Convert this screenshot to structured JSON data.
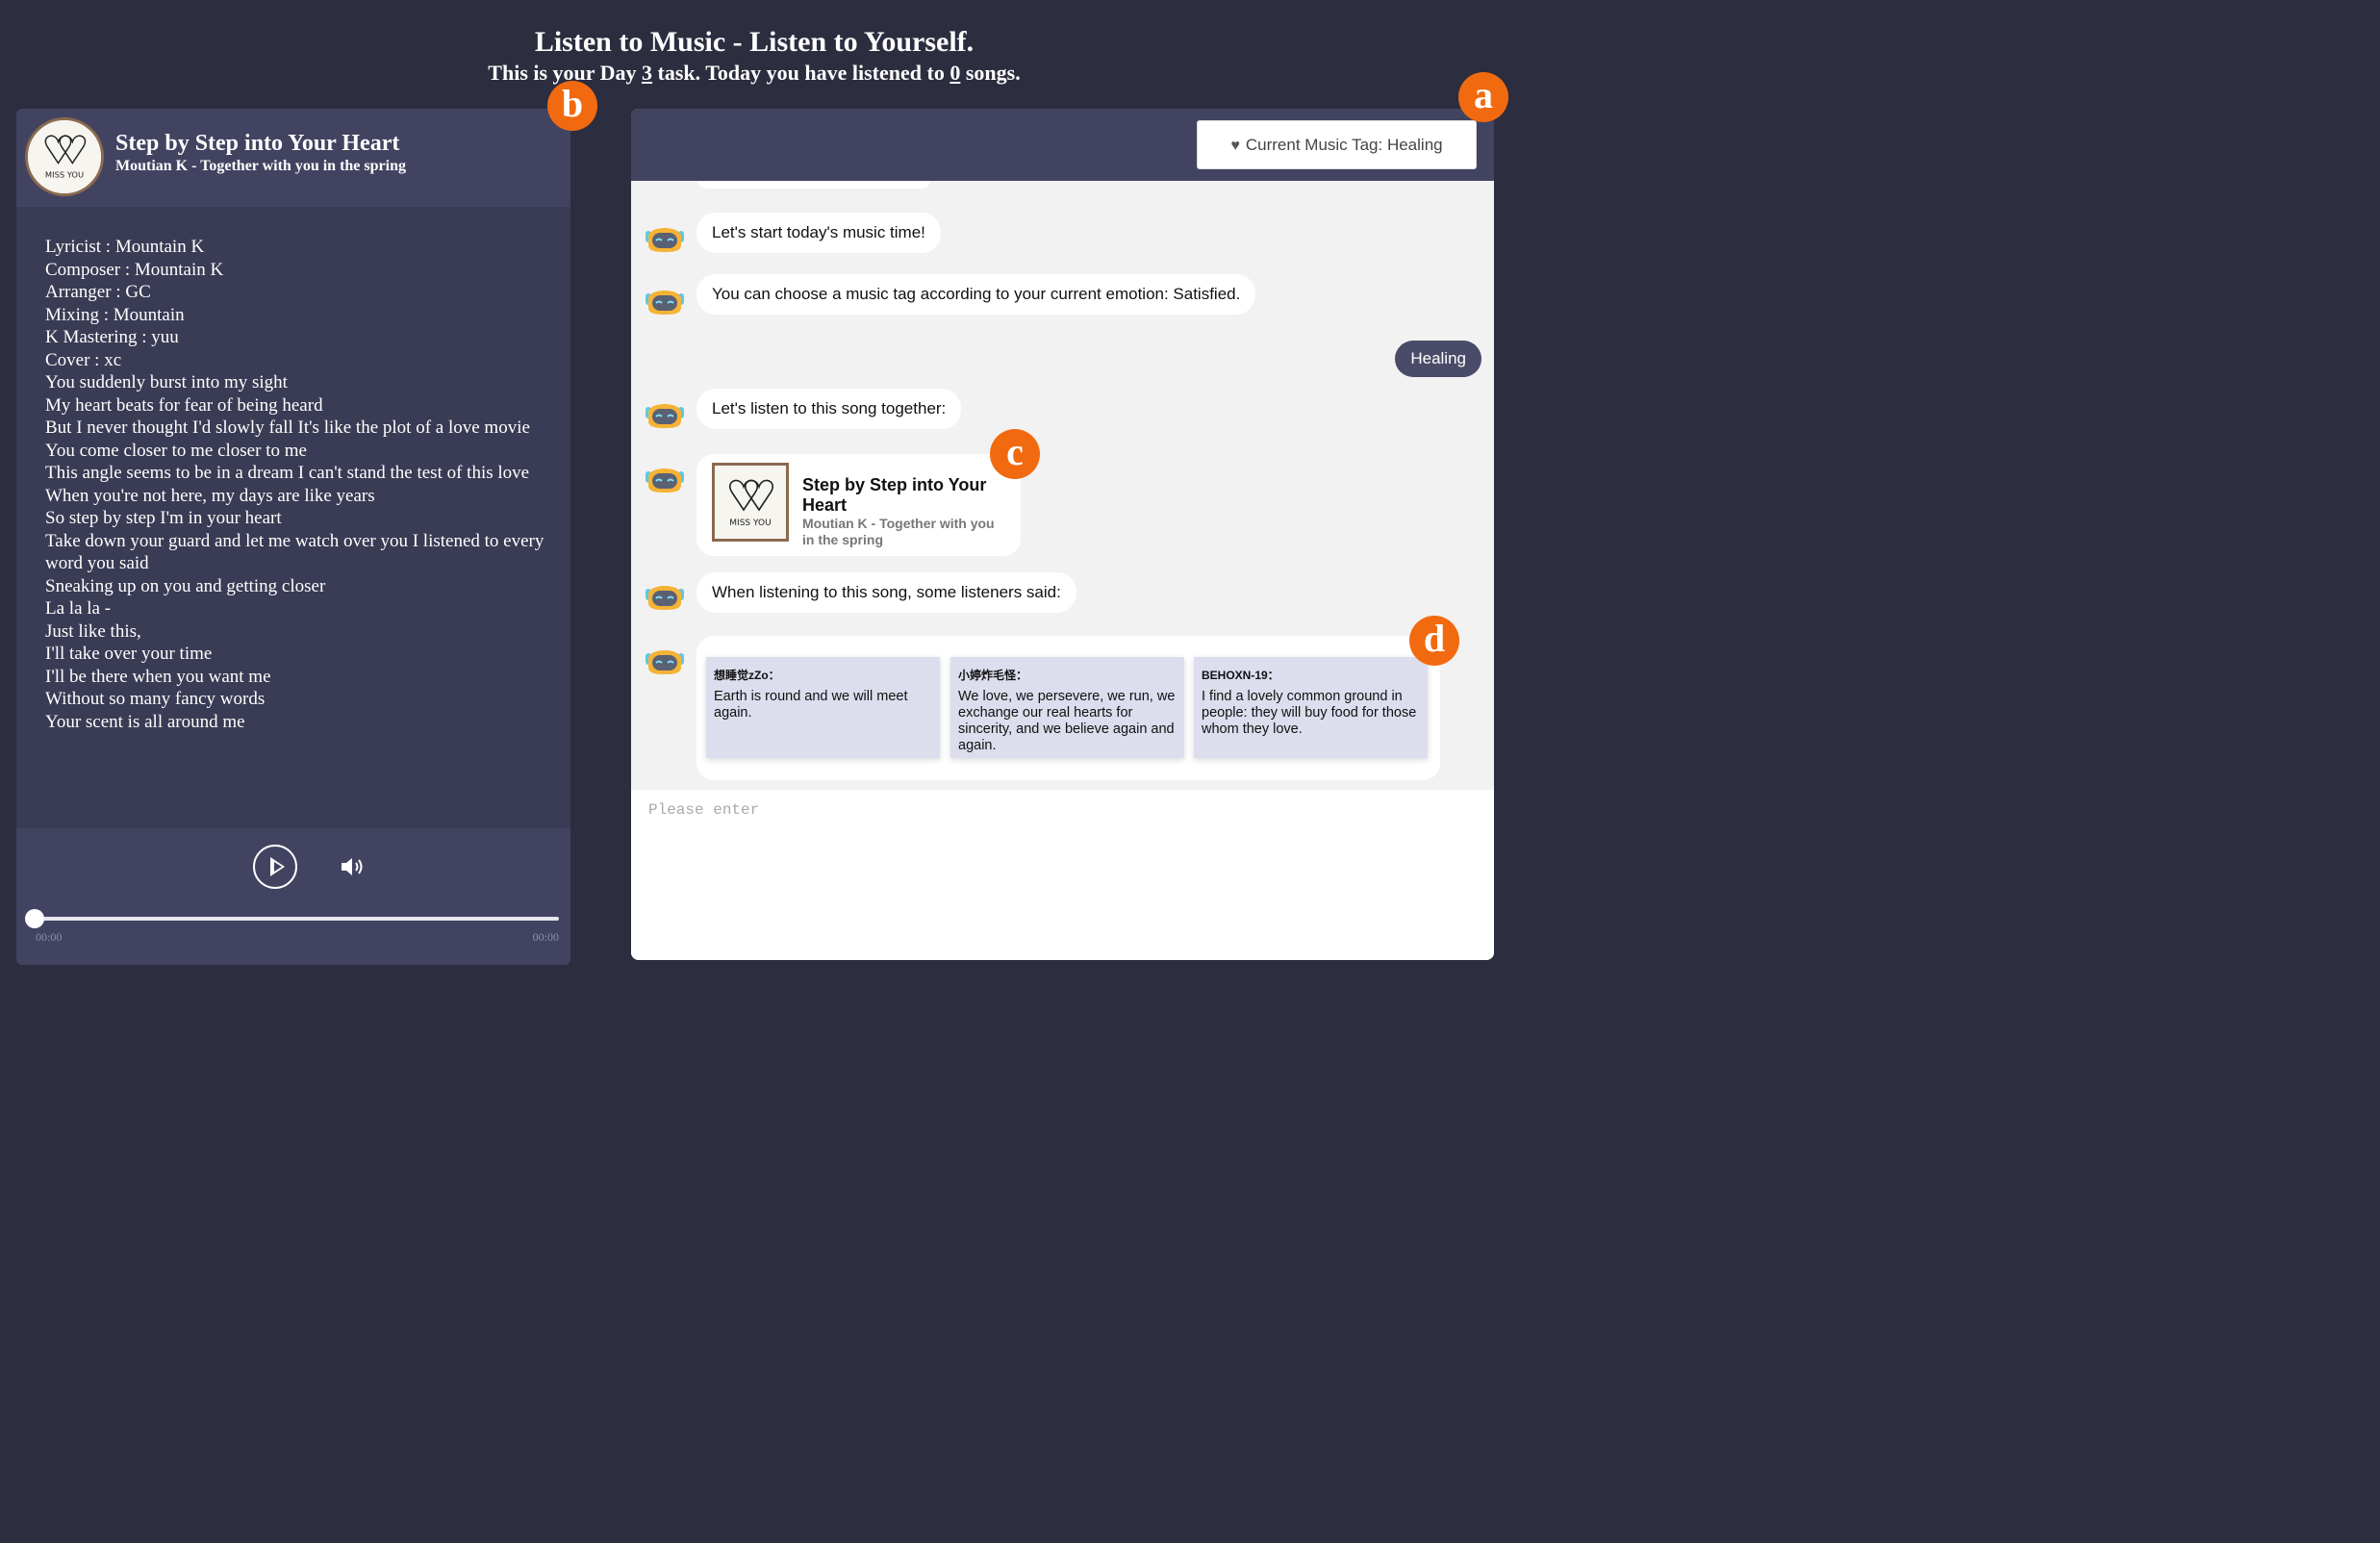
{
  "header": {
    "title": "Listen to Music - Listen to Yourself.",
    "subtitle_pre": "This is your Day ",
    "day": "3",
    "subtitle_mid": " task. Today you have listened to ",
    "count": "0",
    "subtitle_post": " songs."
  },
  "badges": {
    "a": "a",
    "b": "b",
    "c": "c",
    "d": "d"
  },
  "player": {
    "song_title": "Step by Step into Your Heart",
    "song_sub": "Moutian K - Together with you in the spring",
    "cover_text": "MISS YOU",
    "lyrics": [
      "Lyricist : Mountain K",
      "Composer : Mountain K",
      "Arranger : GC",
      "Mixing : Mountain",
      "K Mastering : yuu",
      "Cover : xc",
      "You suddenly burst into my sight",
      "My heart beats for fear of being heard",
      "But I never thought I'd slowly fall It's like the plot of a love movie",
      "You come closer to me closer to me",
      "This angle seems to be in a dream I can't stand the test of this love",
      "When you're not here, my days are like years",
      "So step by step I'm in your heart",
      "Take down your guard and let me watch over you I listened to every word you said",
      "Sneaking up on you and getting closer",
      "La la la -",
      "Just like this,",
      "I'll take over your time",
      "I'll be there when you want me",
      "Without so many fancy words",
      "Your scent is all around me"
    ],
    "time_current": "00:00",
    "time_total": "00:00",
    "progress": 0,
    "play_icon": "play-circle-icon",
    "volume_icon": "volume-icon"
  },
  "chat": {
    "tag_button": "Current Music Tag: Healing",
    "tag_icon": "heart-icon",
    "messages": {
      "m1": "Let's start today's music time!",
      "m2": "You can choose a music tag according to your current emotion: Satisfied.",
      "user_reply": "Healing",
      "m3": "Let's listen to this song together:",
      "m4": "When listening to this song, some listeners said:"
    },
    "song_card": {
      "title": "Step by Step into Your Heart",
      "sub": "Moutian K - Together with you in the spring",
      "cover_text": "MISS YOU"
    },
    "comments": [
      {
        "name": "想睡觉zZo：",
        "text": "Earth is round and we will meet again."
      },
      {
        "name": "小婷炸毛怪：",
        "text": "We love, we persevere, we run, we exchange our real hearts for sincerity, and we believe again and again."
      },
      {
        "name": "BEHOXN-19：",
        "text": "I find a lovely common ground in people: they will buy food for those whom they love."
      }
    ],
    "input_placeholder": "Please enter"
  },
  "colors": {
    "background": "#2c2d3f",
    "panel": "#3a3b54",
    "panel_header": "#424361",
    "badge": "#f26a0f",
    "user_bubble": "#4a4b69",
    "comment_card": "#dcdded",
    "bot_avatar": "#f5b335"
  }
}
